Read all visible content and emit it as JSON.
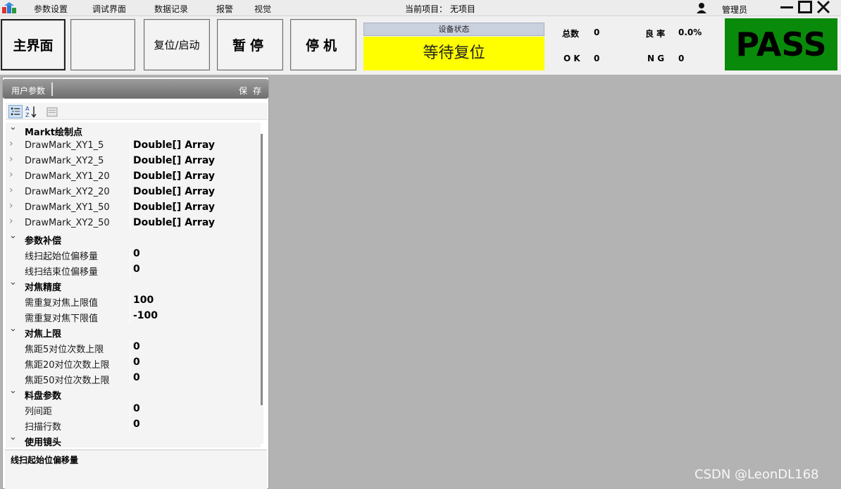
{
  "menu": {
    "items": [
      "参数设置",
      "调试界面",
      "数据记录",
      "报警",
      "视觉"
    ],
    "current_project": "当前项目： 无项目",
    "user": "管理员"
  },
  "toolbar": {
    "main_label": "主界面",
    "blank_label": "",
    "reset_label": "复位/启动",
    "pause_label": "暂停",
    "stop_label": "停机"
  },
  "status": {
    "title": "设备状态",
    "value": "等待复位",
    "value_color": "#ffff00"
  },
  "stats": {
    "total_label": "总数",
    "total_value": "0",
    "yield_label": "良 率",
    "yield_value": "0.0%",
    "ok_label": "O K",
    "ok_value": "0",
    "ng_label": "N G",
    "ng_value": "0"
  },
  "result": {
    "label": "PASS",
    "color": "#0a8a0a"
  },
  "panel": {
    "title": "用户参数",
    "save_label": "保 存",
    "tools": [
      "categorized-icon",
      "alphabetical-icon",
      "property-pages-icon"
    ]
  },
  "grid": {
    "categories": [
      {
        "label": "Markt绘制点",
        "props": [
          {
            "name": "DrawMark_XY1_5",
            "value": "Double[] Array"
          },
          {
            "name": "DrawMark_XY2_5",
            "value": "Double[] Array"
          },
          {
            "name": "DrawMark_XY1_20",
            "value": "Double[] Array"
          },
          {
            "name": "DrawMark_XY2_20",
            "value": "Double[] Array"
          },
          {
            "name": "DrawMark_XY1_50",
            "value": "Double[] Array"
          },
          {
            "name": "DrawMark_XY2_50",
            "value": "Double[] Array"
          }
        ]
      },
      {
        "label": "参数补偿",
        "props": [
          {
            "name": "线扫起始位偏移量",
            "value": "0"
          },
          {
            "name": "线扫结束位偏移量",
            "value": "0"
          }
        ]
      },
      {
        "label": "对焦精度",
        "props": [
          {
            "name": "需重复对焦上限值",
            "value": "100"
          },
          {
            "name": "需重复对焦下限值",
            "value": "-100"
          }
        ]
      },
      {
        "label": "对焦上限",
        "props": [
          {
            "name": "焦距5对位次数上限",
            "value": "0"
          },
          {
            "name": "焦距20对位次数上限",
            "value": "0"
          },
          {
            "name": "焦距50对位次数上限",
            "value": "0"
          }
        ]
      },
      {
        "label": "料盘参数",
        "props": [
          {
            "name": "列间距",
            "value": "0"
          },
          {
            "name": "扫描行数",
            "value": "0"
          }
        ]
      },
      {
        "label": "使用镜头",
        "props": []
      }
    ]
  },
  "description": {
    "title": "线扫起始位偏移量"
  },
  "watermark": "CSDN @LeonDL168"
}
